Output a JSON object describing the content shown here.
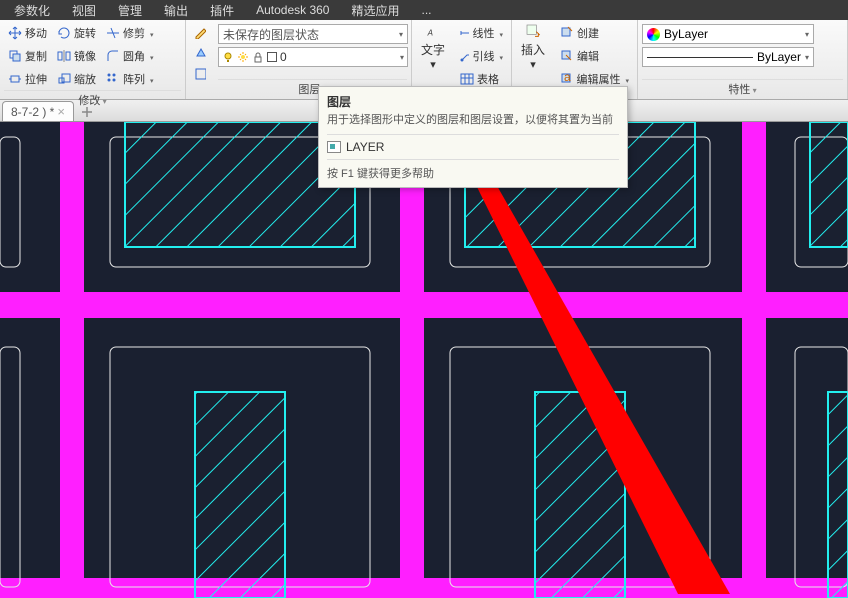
{
  "menu": {
    "items": [
      "参数化",
      "视图",
      "管理",
      "输出",
      "插件",
      "Autodesk 360",
      "精选应用",
      "..."
    ]
  },
  "ribbon": {
    "modify": {
      "label": "修改",
      "rows": [
        [
          "移动",
          "旋转",
          "修剪"
        ],
        [
          "复制",
          "镜像",
          "圆角"
        ],
        [
          "拉伸",
          "缩放",
          "阵列"
        ]
      ]
    },
    "brush_stack": [
      "pen",
      "paint",
      "shape"
    ],
    "layer": {
      "label": "图层",
      "state": "未保存的图层状态",
      "current": "0"
    },
    "text_big": {
      "label": "文字"
    },
    "annotations": {
      "rows": [
        [
          "线性"
        ],
        [
          "引线"
        ],
        [
          "表格"
        ]
      ]
    },
    "insert_big": {
      "label": "插入"
    },
    "block": {
      "rows": [
        [
          "创建"
        ],
        [
          "编辑"
        ],
        [
          "编辑属性"
        ]
      ]
    },
    "props": {
      "label": "特性",
      "bylayer_color": "ByLayer",
      "bylayer_line": "ByLayer"
    }
  },
  "tab": {
    "name": "8-7-2 ) *"
  },
  "tooltip": {
    "title": "图层",
    "desc": "用于选择图形中定义的图层和图层设置，以便将其置为当前",
    "cmd": "LAYER",
    "help": "按 F1 键获得更多帮助"
  }
}
